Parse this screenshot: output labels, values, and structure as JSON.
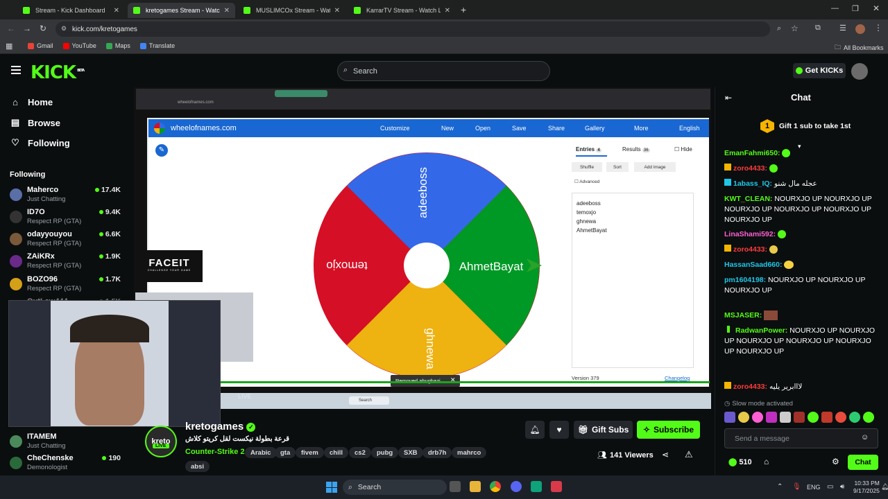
{
  "browser": {
    "tabs": [
      {
        "title": "Stream - Kick Dashboard",
        "active": false
      },
      {
        "title": "kretogames Stream - Watch Live",
        "active": true
      },
      {
        "title": "MUSLIMCOx Stream - Watch Live",
        "active": false
      },
      {
        "title": "KarrarTV Stream - Watch Live o",
        "active": false
      }
    ],
    "url": "kick.com/kretogames",
    "bookmarks": [
      "Gmail",
      "YouTube",
      "Maps",
      "Translate"
    ],
    "all_bookmarks": "All Bookmarks"
  },
  "header": {
    "logo": "KICK",
    "beta": "BETA",
    "search_placeholder": "Search",
    "get_kicks": "Get KICKs"
  },
  "sidebar": {
    "nav": [
      {
        "label": "Home",
        "icon": "home-icon"
      },
      {
        "label": "Browse",
        "icon": "browse-icon"
      },
      {
        "label": "Following",
        "icon": "heart-icon"
      }
    ],
    "following_title": "Following",
    "channels": [
      {
        "name": "Maherco",
        "category": "Just Chatting",
        "viewers": "17.4K",
        "color": "#5a6fa8"
      },
      {
        "name": "ID7O",
        "category": "Respect RP (GTA)",
        "viewers": "9.4K",
        "color": "#333"
      },
      {
        "name": "odayyouyou",
        "category": "Respect RP (GTA)",
        "viewers": "6.6K",
        "color": "#7a5a3a"
      },
      {
        "name": "ZAiKRx",
        "category": "Respect RP (GTA)",
        "viewers": "1.9K",
        "color": "#6a2a8a"
      },
      {
        "name": "BOZO96",
        "category": "Respect RP (GTA)",
        "viewers": "1.7K",
        "color": "#d4a017"
      },
      {
        "name": "OutLaw444",
        "category": "",
        "viewers": "1.5K",
        "color": "#445"
      }
    ],
    "bottom_channels": [
      {
        "name": "ITAMEM",
        "category": "Just Chatting",
        "viewers": "",
        "color": "#4a8a5a"
      },
      {
        "name": "CheChenske",
        "category": "Demonologist",
        "viewers": "190",
        "color": "#2a6a3a"
      }
    ]
  },
  "video": {
    "inner_url": "wheelofnames.com",
    "site": "wheelofnames.com",
    "menu": [
      "Customize",
      "New",
      "Open",
      "Save",
      "Share",
      "Gallery",
      "More",
      "English"
    ],
    "wheel_entries": [
      "adeeboss",
      "temoxjo",
      "ghnewa",
      "AhmetBayat"
    ],
    "tabs": {
      "entries": "Entries",
      "entries_count": "4",
      "results": "Results",
      "results_count": "36",
      "hide": "Hide"
    },
    "actions": [
      "Shuffle",
      "Sort",
      "Add image"
    ],
    "advanced": "Advanced",
    "version": "Version 379",
    "changelog": "Changelog",
    "toast": "Removed abughazi",
    "live_tag": "LIVE",
    "faceit": "FACEIT",
    "faceit_sub": "CHALLENGE YOUR GAME",
    "inner_search": "Search"
  },
  "stream": {
    "channel": "kretogames",
    "avatar_text": "kreto",
    "live": "LIVE",
    "title": "قرعة بطولة نيكست لقل كريتو كلاش",
    "category": "Counter-Strike 2",
    "tags": [
      "Arabic",
      "gta",
      "fivem",
      "chill",
      "cs2",
      "pubg",
      "SXB",
      "drb7h",
      "mahrco",
      "absi"
    ],
    "viewers": "141",
    "viewers_label": "Viewers",
    "gift_subs": "Gift Subs",
    "subscribe": "Subscribe"
  },
  "chat": {
    "title": "Chat",
    "gift_banner": "Gift 1 sub to take 1st",
    "gift_rank": "1",
    "messages": [
      {
        "user": "EmanFahmi650:",
        "text": "",
        "color": "#53fc18"
      },
      {
        "user": "zoro4433:",
        "text": "",
        "color": "#ff3b3b"
      },
      {
        "user": "1abass_IQ:",
        "text": "عجله مال شنو",
        "color": "#1ec7e8"
      },
      {
        "user": "KWT_CLEAN:",
        "text": "NOURXJO UP NOURXJO UP NOURXJO UP NOURXJO UP NOURXJO UP NOURXJO UP",
        "color": "#53fc18"
      },
      {
        "user": "LinaShami592:",
        "text": "",
        "color": "#ff5fd2"
      },
      {
        "user": "zoro4433:",
        "text": "",
        "color": "#ff3b3b"
      },
      {
        "user": "HassanSaad660:",
        "text": "",
        "color": "#1ec7e8"
      },
      {
        "user": "pm1604198:",
        "text": "NOURXJO UP NOURXJO UP NOURXJO UP",
        "color": "#1ec7e8"
      },
      {
        "user": "MSJASER:",
        "text": "",
        "color": "#53fc18"
      },
      {
        "user": "RadwanPower:",
        "text": "NOURXJO UP NOURXJO UP NOURXJO UP NOURXJO UP NOURXJO UP NOURXJO UP",
        "color": "#53fc18"
      },
      {
        "user": "zoro4433:",
        "text": "لااابرير يليه",
        "color": "#ff3b3b"
      }
    ],
    "slow_mode": "Slow mode activated",
    "input_placeholder": "Send a message",
    "points": "510",
    "chat_button": "Chat"
  },
  "taskbar": {
    "search": "Search",
    "lang": "ENG",
    "time": "10:33 PM",
    "date": "9/17/2025"
  }
}
